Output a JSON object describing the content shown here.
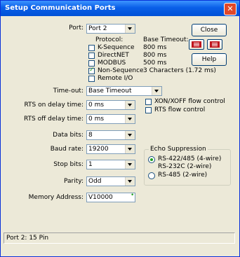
{
  "window": {
    "title": "Setup Communication Ports"
  },
  "port": {
    "label": "Port:",
    "value": "Port 2"
  },
  "buttons": {
    "close": "Close",
    "help": "Help"
  },
  "protocol": {
    "label": "Protocol:",
    "timeout_header": "Base Timeout:",
    "items": [
      {
        "label": "K-Sequence",
        "checked": false,
        "timeout": "800 ms"
      },
      {
        "label": "DirectNET",
        "checked": false,
        "timeout": "800 ms"
      },
      {
        "label": "MODBUS",
        "checked": false,
        "timeout": "500 ms"
      },
      {
        "label": "Non-Sequence",
        "checked": true,
        "timeout": "3 Characters (1.72 ms)"
      },
      {
        "label": "Remote I/O",
        "checked": false,
        "timeout": ""
      }
    ]
  },
  "timeout": {
    "label": "Time-out:",
    "value": "Base Timeout"
  },
  "rts_on": {
    "label": "RTS on delay time:",
    "value": "0 ms"
  },
  "rts_off": {
    "label": "RTS off delay time:",
    "value": "0 ms"
  },
  "data_bits": {
    "label": "Data bits:",
    "value": "8"
  },
  "baud_rate": {
    "label": "Baud rate:",
    "value": "19200"
  },
  "stop_bits": {
    "label": "Stop bits:",
    "value": "1"
  },
  "parity": {
    "label": "Parity:",
    "value": "Odd"
  },
  "memory_address": {
    "label": "Memory Address:",
    "value": "V10000"
  },
  "flow_control": {
    "xon_xoff": {
      "label": "XON/XOFF flow control",
      "checked": false
    },
    "rts": {
      "label": "RTS flow control",
      "checked": false
    }
  },
  "echo": {
    "legend": "Echo Suppression",
    "options": [
      {
        "label": "RS-422/485 (4-wire)",
        "label2": "RS-232C (2-wire)",
        "selected": true
      },
      {
        "label": "RS-485 (2-wire)",
        "selected": false
      }
    ]
  },
  "status_bar": {
    "text": "Port 2: 15 Pin"
  },
  "colors": {
    "title_bar": "#0a5fe8",
    "dialog_bg": "#ece9d8",
    "close_button": "#e0482a"
  }
}
